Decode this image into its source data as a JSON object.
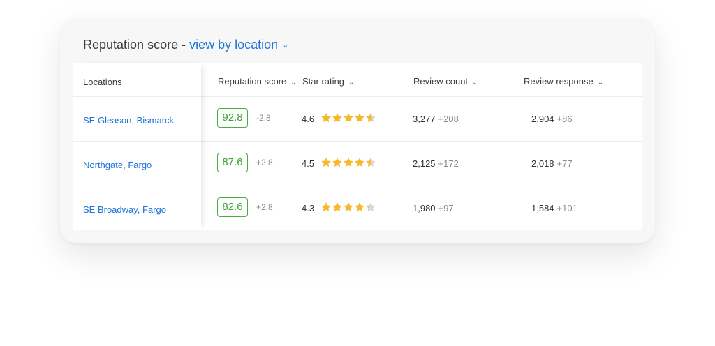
{
  "header": {
    "title_prefix": "Reputation score - ",
    "title_link": "view by location",
    "chevron_icon": "chevron-down-icon"
  },
  "columns": {
    "locations": "Locations",
    "reputation_score": "Reputation score",
    "star_rating": "Star rating",
    "review_count": "Review count",
    "review_response": "Review response"
  },
  "rows": [
    {
      "location": "SE Gleason, Bismarck",
      "score": "92.8",
      "score_delta": "-2.8",
      "rating": "4.6",
      "rating_value": 4.6,
      "review_count": "3,277",
      "review_count_delta": "+208",
      "review_response": "2,904",
      "review_response_delta": "+86"
    },
    {
      "location": "Northgate, Fargo",
      "score": "87.6",
      "score_delta": "+2.8",
      "rating": "4.5",
      "rating_value": 4.5,
      "review_count": "2,125",
      "review_count_delta": "+172",
      "review_response": "2,018",
      "review_response_delta": "+77"
    },
    {
      "location": "SE Broadway, Fargo",
      "score": "82.6",
      "score_delta": "+2.8",
      "rating": "4.3",
      "rating_value": 4.3,
      "review_count": "1,980",
      "review_count_delta": "+97",
      "review_response": "1,584",
      "review_response_delta": "+101"
    }
  ],
  "colors": {
    "accent": "#1a73d9",
    "score_green": "#44b13a",
    "star_gold": "#f7b928",
    "star_empty": "#d9d9d9"
  }
}
